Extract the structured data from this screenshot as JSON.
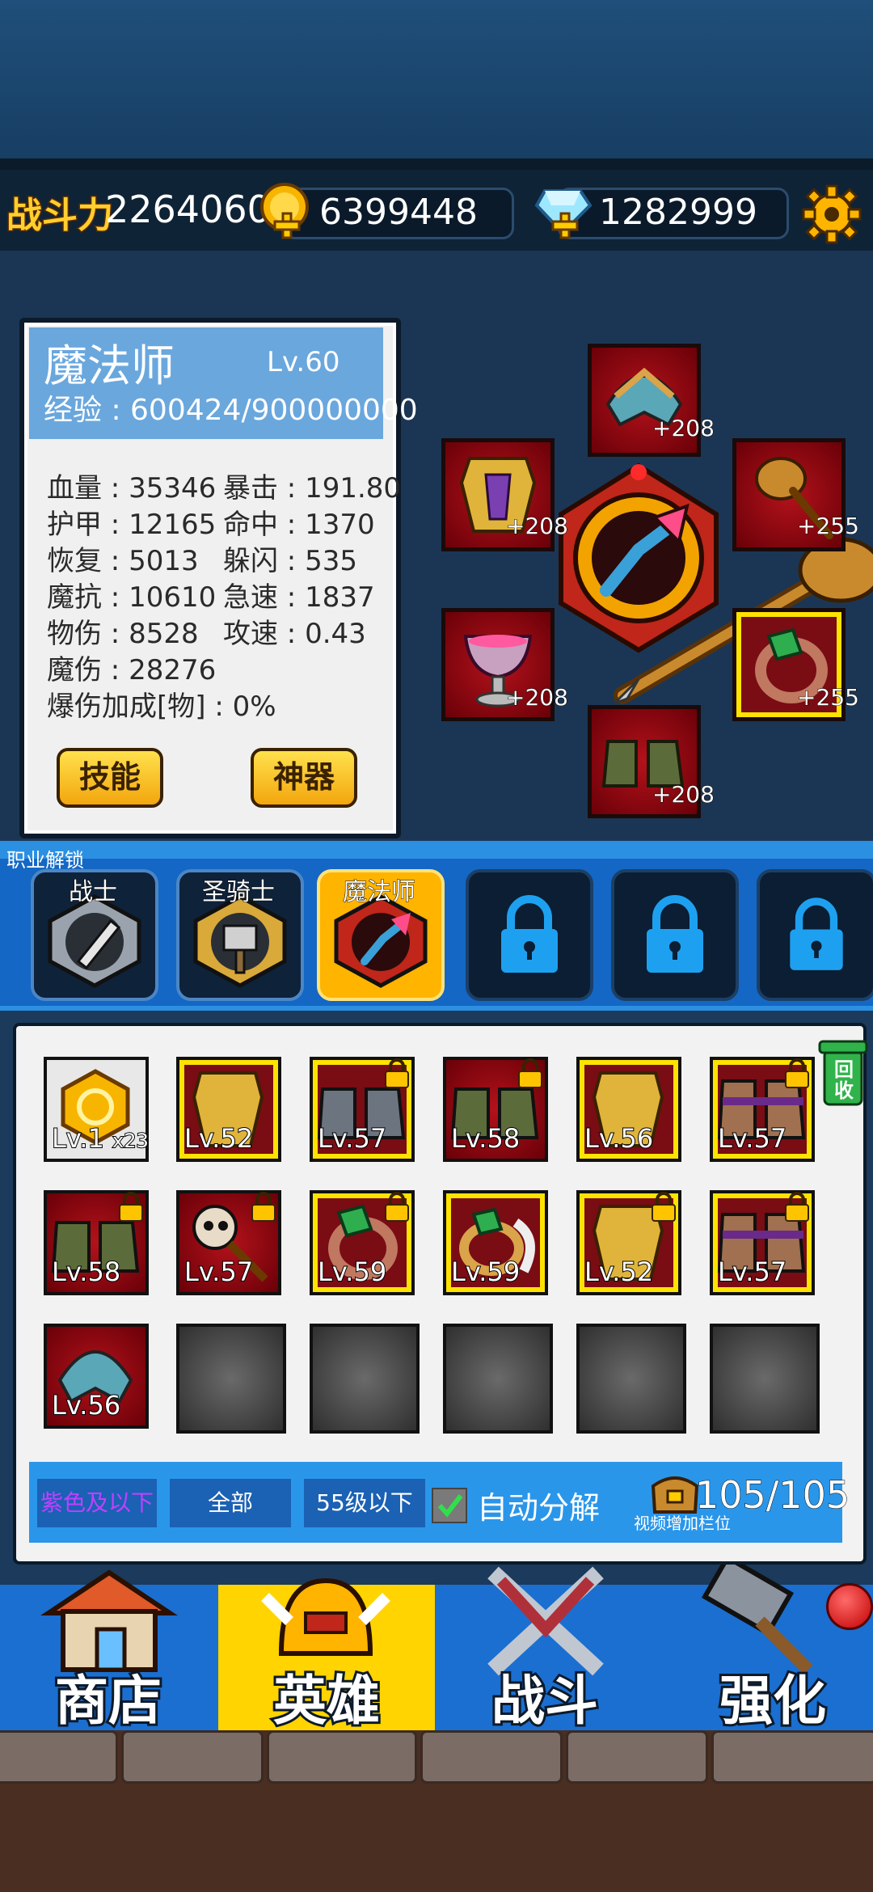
{
  "topbar": {
    "power_label": "战斗力",
    "power_value": "2264060",
    "gold_value": "6399448",
    "gem_value": "1282999"
  },
  "hero": {
    "name": "魔法师",
    "level": "Lv.60",
    "exp": "经验 : 600424/900000000",
    "stats": [
      "血量 : 35346",
      "暴击 : 191.80",
      "护甲 : 12165",
      "命中 : 1370",
      "恢复 : 5013",
      "躲闪 : 535",
      "魔抗 : 10610",
      "急速 : 1837",
      "物伤 : 8528",
      "攻速 : 0.43",
      "魔伤 : 28276",
      "爆伤加成[物] : 0%"
    ],
    "skill_button": "技能",
    "artifact_button": "神器"
  },
  "equipment_slots": [
    {
      "name": "helmet",
      "plus": "+208"
    },
    {
      "name": "armor",
      "plus": "+208"
    },
    {
      "name": "weapon",
      "plus": "+255"
    },
    {
      "name": "necklace",
      "plus": "+208"
    },
    {
      "name": "ring",
      "plus": "+255"
    },
    {
      "name": "boots",
      "plus": "+208"
    }
  ],
  "classes": {
    "unlock_label": "职业解锁",
    "items": [
      {
        "label": "战士"
      },
      {
        "label": "圣骑士"
      },
      {
        "label": "魔法师"
      }
    ]
  },
  "inventory": {
    "recycle_label": "回收",
    "items": [
      {
        "lv": "Lv.1",
        "extra": "x23"
      },
      {
        "lv": "Lv.52"
      },
      {
        "lv": "Lv.57"
      },
      {
        "lv": "Lv.58"
      },
      {
        "lv": "Lv.56"
      },
      {
        "lv": "Lv.57"
      },
      {
        "lv": "Lv.58"
      },
      {
        "lv": "Lv.57"
      },
      {
        "lv": "Lv.59"
      },
      {
        "lv": "Lv.59"
      },
      {
        "lv": "Lv.52"
      },
      {
        "lv": "Lv.57"
      },
      {
        "lv": "Lv.56"
      }
    ],
    "filters": [
      "紫色及以下",
      "全部",
      "55级以下"
    ],
    "auto_decompose": "自动分解",
    "capacity": "105/105",
    "capacity_hint": "视频增加栏位"
  },
  "nav": [
    {
      "label": "商店"
    },
    {
      "label": "英雄"
    },
    {
      "label": "战斗"
    },
    {
      "label": "强化"
    }
  ],
  "colors": {
    "accent_yellow": "#ffd400",
    "nav_blue": "#1a6fd1",
    "slot_red": "#b3121b"
  }
}
